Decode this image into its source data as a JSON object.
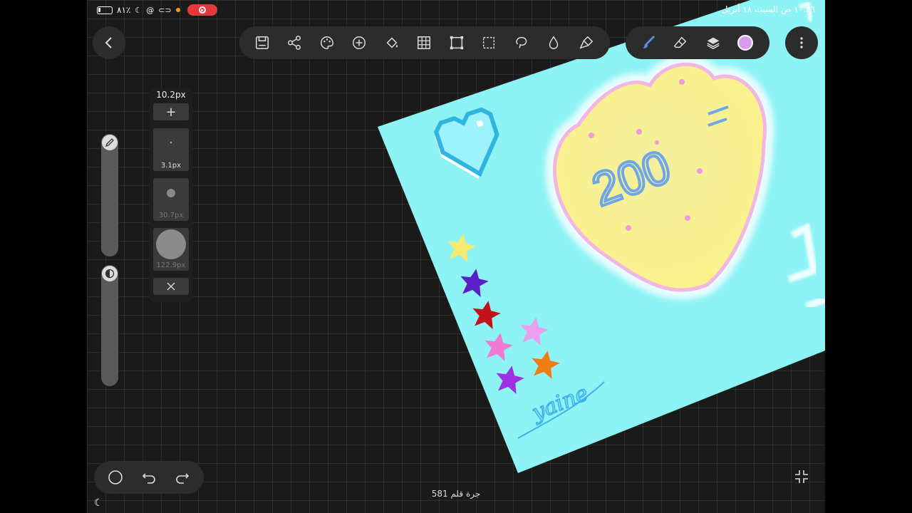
{
  "status_bar": {
    "battery_text": "٨١٪",
    "datetime": "١٠:٣٦ ص  السبت ١٨ أبريل"
  },
  "toolbar": {
    "tools": [
      "save-icon",
      "share-icon",
      "palette-icon",
      "add-icon",
      "fill-icon",
      "grid-icon",
      "transform-icon",
      "select-icon",
      "lasso-icon",
      "liquify-icon",
      "smudge-icon"
    ],
    "active_tools": [
      "brush-icon",
      "eraser-icon",
      "layers-icon",
      "color-swatch"
    ],
    "current_color": "#d79cf0"
  },
  "brush_panel": {
    "size": "10.2px",
    "presets": [
      {
        "label": "3.1px"
      },
      {
        "label": "30.7px"
      },
      {
        "label": "122.9px"
      }
    ]
  },
  "artwork": {
    "heart_text": "200",
    "signature": "yaine",
    "background_color": "#8ef3f5"
  },
  "footer": {
    "stroke_count": "581 جرة قلم"
  }
}
